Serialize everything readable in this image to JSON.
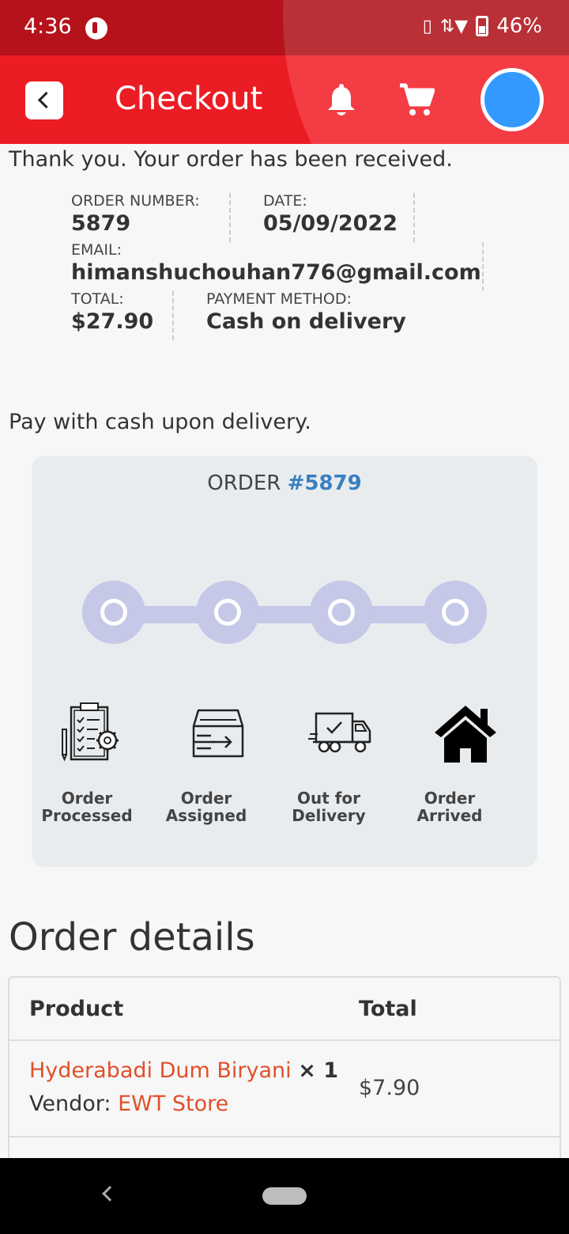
{
  "status_bar": {
    "time": "4:36",
    "battery": "46%"
  },
  "app_bar": {
    "title": "Checkout"
  },
  "thank_you": "Thank you. Your order has been received.",
  "overview": {
    "order_number_label": "ORDER NUMBER:",
    "order_number": "5879",
    "date_label": "DATE:",
    "date": "05/09/2022",
    "email_label": "EMAIL:",
    "email": "himanshuchouhan776@gmail.com",
    "total_label": "TOTAL:",
    "total": "$27.90",
    "payment_label": "PAYMENT METHOD:",
    "payment": "Cash on delivery"
  },
  "pay_note": "Pay with cash upon delivery.",
  "tracker": {
    "title_prefix": "ORDER ",
    "order_ref": "#5879",
    "steps": [
      {
        "line1": "Order",
        "line2": "Processed",
        "icon": "clipboard-gear-icon"
      },
      {
        "line1": "Order",
        "line2": "Assigned",
        "icon": "inbox-arrow-icon"
      },
      {
        "line1": "Out for",
        "line2": "Delivery",
        "icon": "delivery-truck-icon"
      },
      {
        "line1": "Order",
        "line2": "Arrived",
        "icon": "home-icon"
      }
    ]
  },
  "order_details": {
    "title": "Order details",
    "col_product": "Product",
    "col_total": "Total",
    "items": [
      {
        "name": "Hyderabadi Dum Biryani",
        "qty": "× 1",
        "vendor_label": "Vendor:",
        "vendor": "EWT Store",
        "total": "$7.90"
      }
    ]
  },
  "colors": {
    "header_red": "#ec1c24",
    "status_red": "#b5121b",
    "link": "#e0502a",
    "order_ref": "#3a7fc1",
    "tracker_bg": "#e9ecef",
    "tracker_dot": "#c5c8e7"
  }
}
